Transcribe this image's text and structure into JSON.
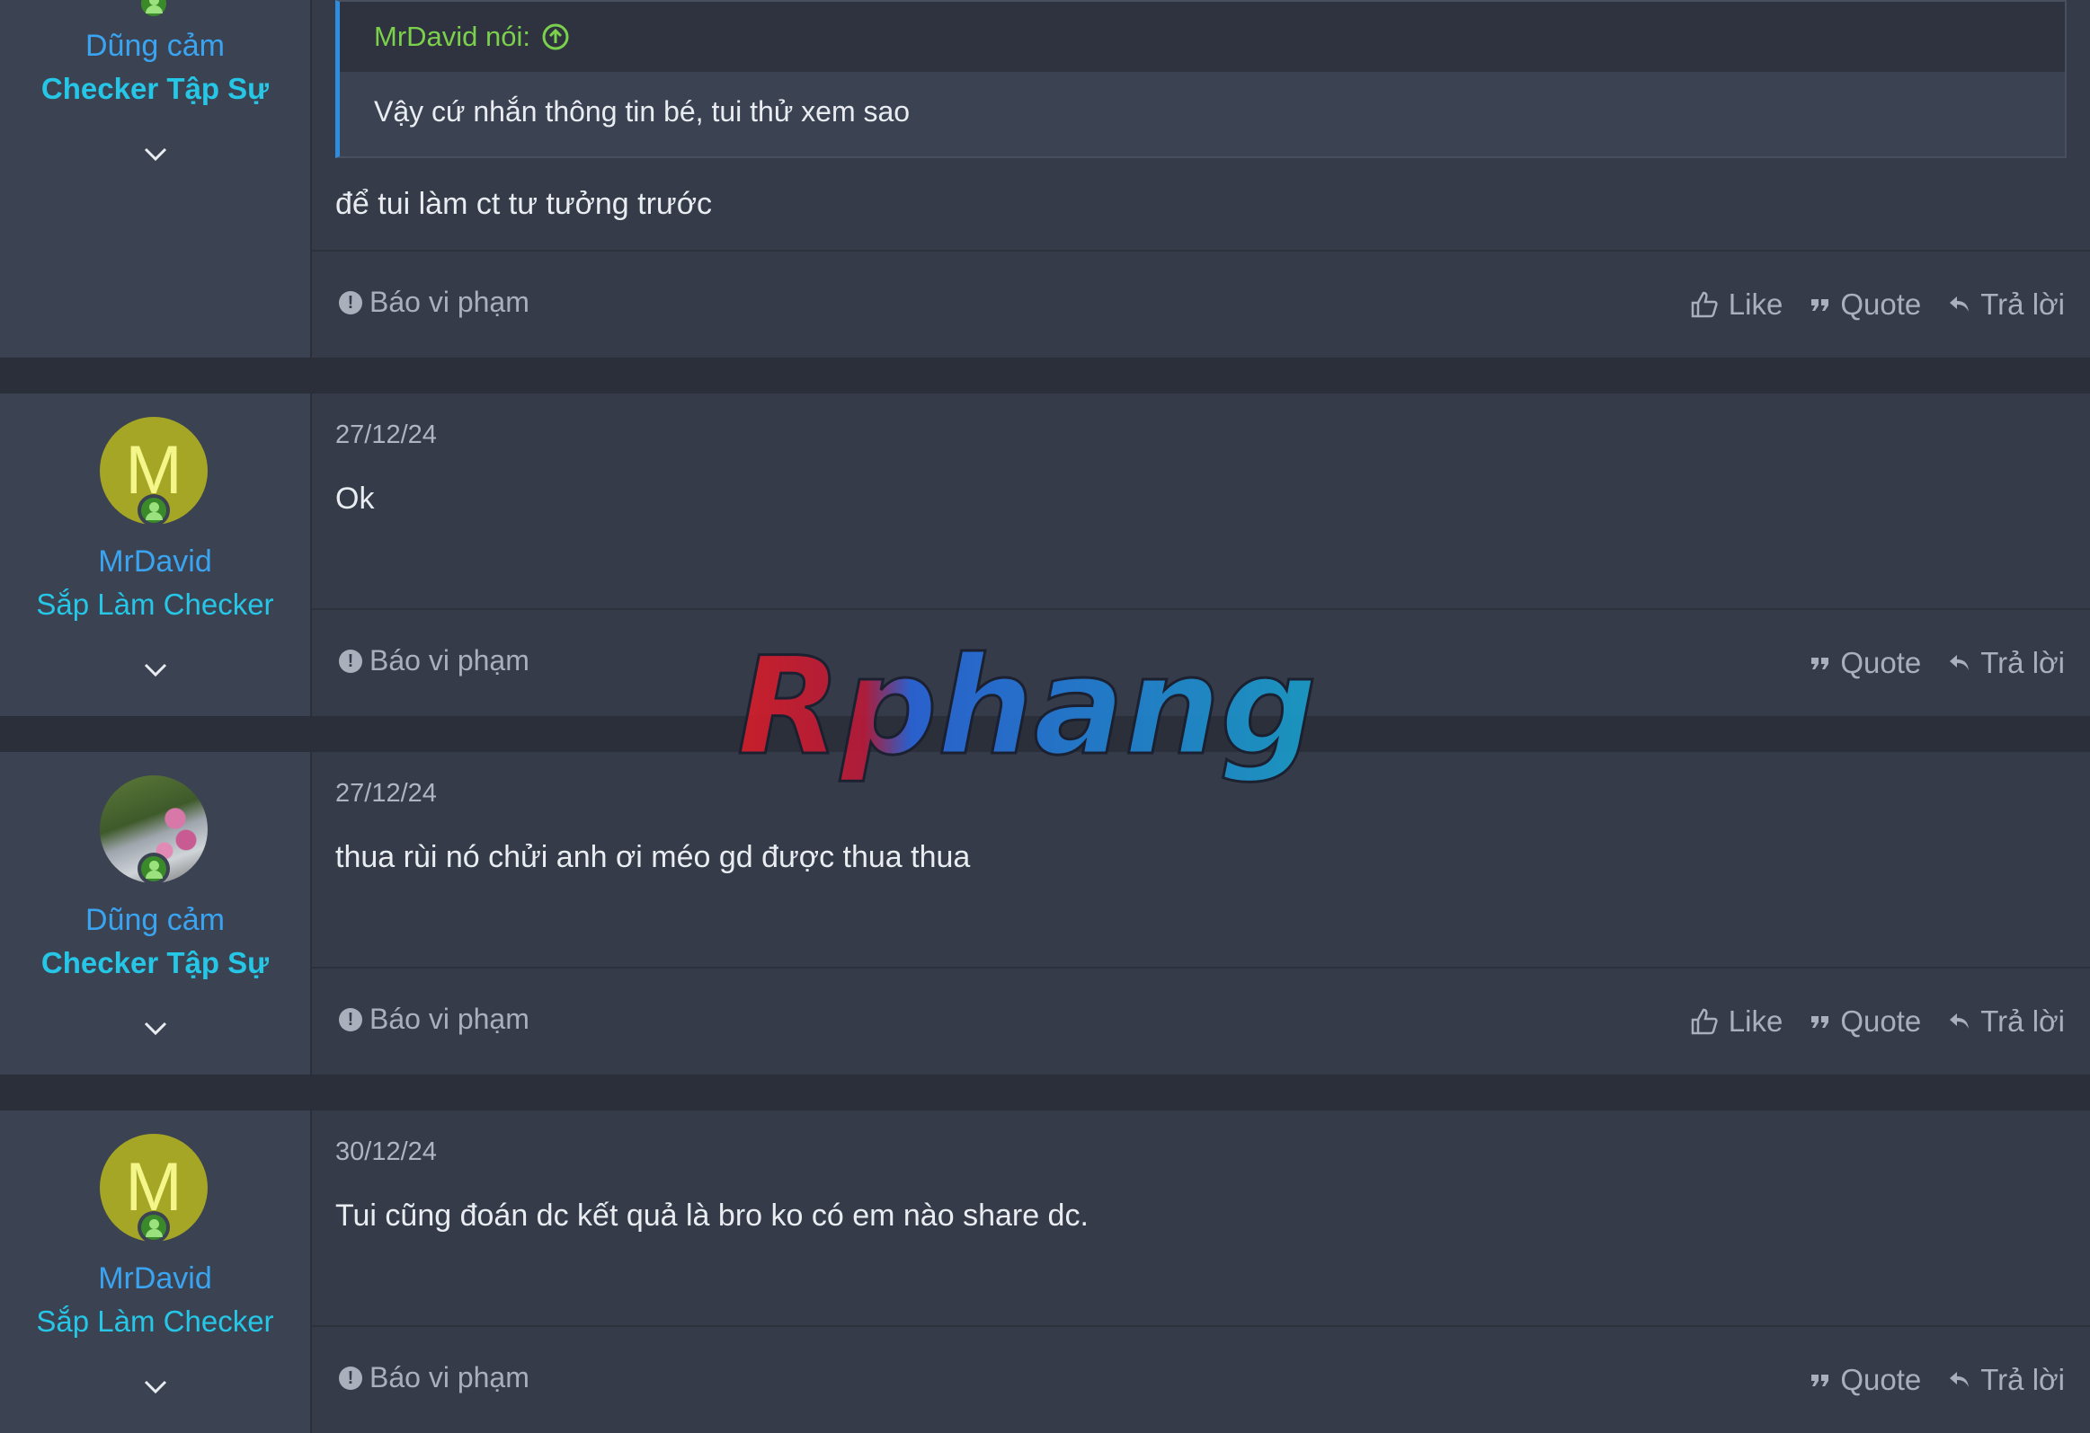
{
  "quoted_post": {
    "user": {
      "name": "Dũng cảm",
      "title": "Checker Tập Sự"
    },
    "quote": {
      "author": "MrDavid nói:",
      "text": "Vậy cứ nhắn thông tin bé, tui thử xem sao"
    },
    "body": "để tui làm ct tư tưởng trước",
    "report_label": "Báo vi phạm",
    "actions": {
      "like": "Like",
      "quote": "Quote",
      "reply": "Trả lời"
    }
  },
  "posts": [
    {
      "user": {
        "avatar_letter": "M",
        "name": "MrDavid",
        "title": "Sắp Làm Checker"
      },
      "date": "27/12/24",
      "body": "Ok",
      "report_label": "Báo vi phạm",
      "actions": {
        "quote": "Quote",
        "reply": "Trả lời"
      }
    },
    {
      "user": {
        "name": "Dũng cảm",
        "title": "Checker Tập Sự"
      },
      "date": "27/12/24",
      "body": "thua rùi nó chửi anh ơi méo gd được thua thua",
      "report_label": "Báo vi phạm",
      "actions": {
        "like": "Like",
        "quote": "Quote",
        "reply": "Trả lời"
      }
    },
    {
      "user": {
        "avatar_letter": "M",
        "name": "MrDavid",
        "title": "Sắp Làm Checker"
      },
      "date": "30/12/24",
      "body": "Tui cũng đoán dc kết quả là bro ko có em nào share dc.",
      "report_label": "Báo vi phạm",
      "actions": {
        "quote": "Quote",
        "reply": "Trả lời"
      }
    }
  ],
  "watermark": "Rphang",
  "colors": {
    "username": "#3aa4f0",
    "user_title": "#26c6e6",
    "quote_author": "#7bd04c",
    "avatar_bg": "#a5a625",
    "online": "#3a8a2a"
  }
}
